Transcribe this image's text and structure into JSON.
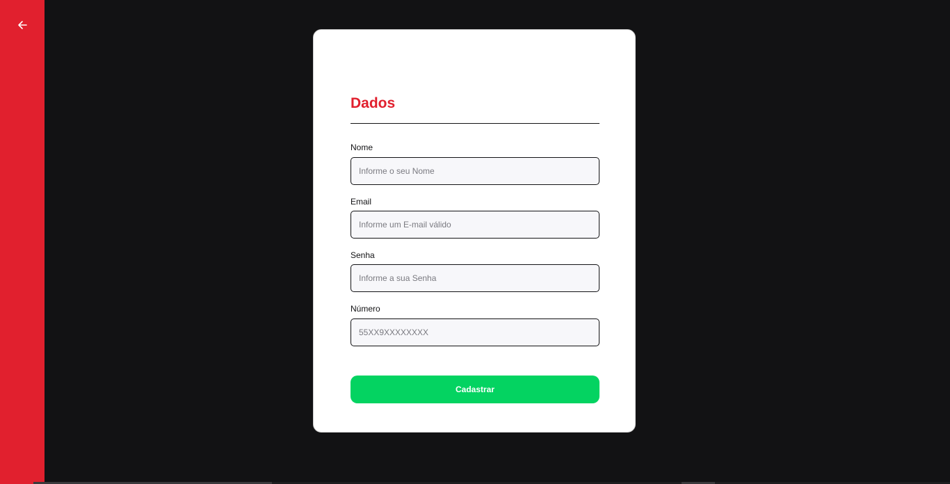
{
  "colors": {
    "accent": "#e1202e",
    "background": "#121214",
    "card": "#ffffff",
    "submit": "#04d361",
    "field_bg": "#f7f7fa"
  },
  "sidebar": {
    "back_icon": "arrow-left-icon"
  },
  "form": {
    "title": "Dados",
    "fields": [
      {
        "label": "Nome",
        "placeholder": "Informe o seu Nome",
        "value": ""
      },
      {
        "label": "Email",
        "placeholder": "Informe um E-mail válido",
        "value": ""
      },
      {
        "label": "Senha",
        "placeholder": "Informe a sua Senha",
        "value": ""
      },
      {
        "label": "Número",
        "placeholder": "55XX9XXXXXXXX",
        "value": ""
      }
    ],
    "submit_label": "Cadastrar"
  }
}
